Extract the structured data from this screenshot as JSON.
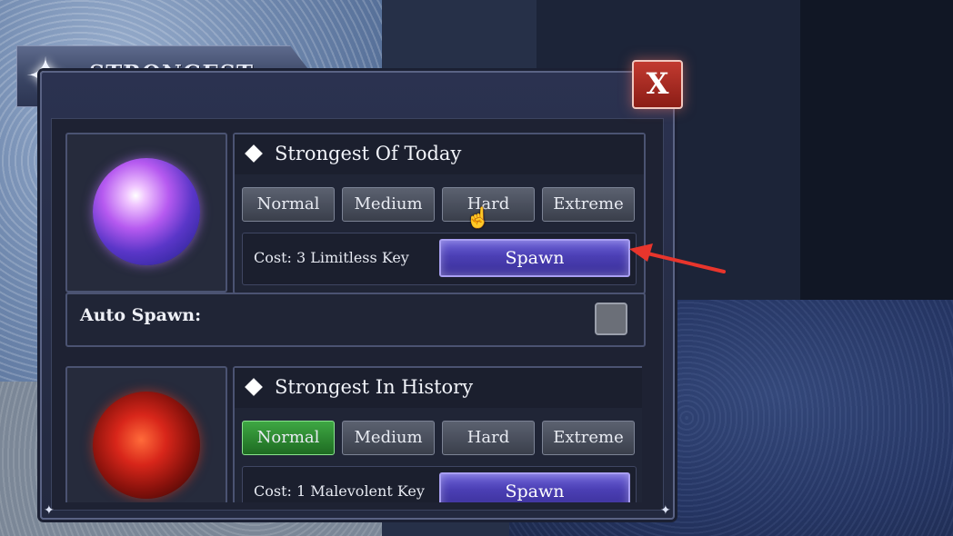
{
  "window": {
    "title": "STRONGEST",
    "close_label": "X"
  },
  "sections": [
    {
      "title": "Strongest Of Today",
      "orb": "purple-orb",
      "difficulties": [
        "Normal",
        "Medium",
        "Hard",
        "Extreme"
      ],
      "selected_difficulty": "",
      "cost": "Cost: 3 Limitless Key",
      "spawn_label": "Spawn"
    },
    {
      "title": "Strongest In History",
      "orb": "red-orb",
      "difficulties": [
        "Normal",
        "Medium",
        "Hard",
        "Extreme"
      ],
      "selected_difficulty": "Normal",
      "cost": "Cost: 1 Malevolent Key",
      "spawn_label": "Spawn"
    }
  ],
  "auto_spawn": {
    "label": "Auto Spawn:",
    "checked": false
  },
  "colors": {
    "selected_green": "#3ea743",
    "spawn_purple": "#4b3fb4",
    "close_red": "#c23a30",
    "annotation_arrow": "#e8352c"
  },
  "icons": [
    "star-icon",
    "diamond-icon",
    "close-icon",
    "hand-cursor-icon",
    "annotation-arrow-icon"
  ]
}
